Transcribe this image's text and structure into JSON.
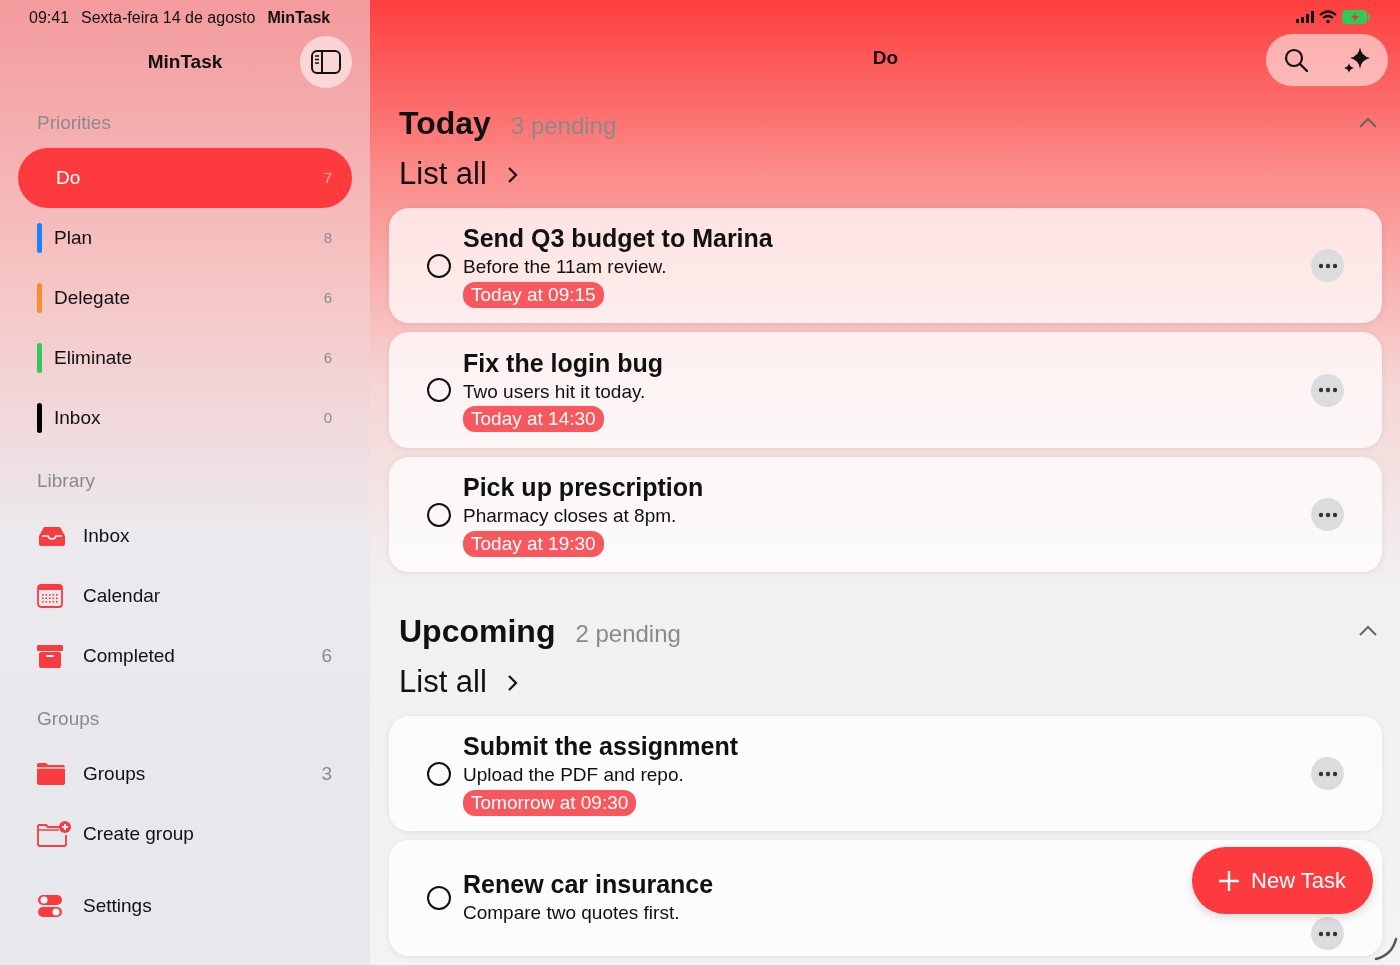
{
  "status_bar": {
    "time": "09:41",
    "date": "Sexta-feira 14 de agosto",
    "app": "MinTask"
  },
  "sidebar": {
    "title": "MinTask",
    "sections": [
      {
        "heading": "Priorities",
        "kind": "priority",
        "items": [
          {
            "label": "Do",
            "count": "7",
            "selected": true
          },
          {
            "label": "Plan",
            "count": "8",
            "selected": false,
            "color": "#1a82fb"
          },
          {
            "label": "Delegate",
            "count": "6",
            "selected": false,
            "color": "#fb8c2c"
          },
          {
            "label": "Eliminate",
            "count": "6",
            "selected": false,
            "color": "#34c759"
          },
          {
            "label": "Inbox",
            "count": "0",
            "selected": false,
            "color": "#000000"
          }
        ]
      },
      {
        "heading": "Library",
        "kind": "library",
        "items": [
          {
            "label": "Inbox",
            "selected": false
          },
          {
            "label": "Calendar",
            "selected": false
          },
          {
            "label": "Completed",
            "count": "6",
            "selected": false
          }
        ]
      },
      {
        "heading": "Groups",
        "kind": "groups",
        "items": [
          {
            "label": "Groups",
            "count": "3",
            "selected": false
          },
          {
            "label": "Create group",
            "selected": false
          }
        ]
      }
    ],
    "settings": "Settings"
  },
  "main": {
    "title": "Do",
    "sections": [
      {
        "title": "Today",
        "pending": "3 pending",
        "expanded": true,
        "link": "List all",
        "tasks": [
          {
            "title": "Send Q3 budget to Marina",
            "note": "Before the 11am review.",
            "due": "Today at 09:15",
            "checked": false
          },
          {
            "title": "Fix the login bug",
            "note": "Two users hit it today.",
            "due": "Today at 14:30",
            "checked": false
          },
          {
            "title": "Pick up prescription",
            "note": "Pharmacy closes at 8pm.",
            "due": "Today at 19:30",
            "checked": false
          }
        ]
      },
      {
        "title": "Upcoming",
        "pending": "2 pending",
        "expanded": true,
        "link": "List all",
        "tasks": [
          {
            "title": "Submit the assignment",
            "note": "Upload the PDF and repo.",
            "due": "Tomorrow at 09:30",
            "checked": false
          },
          {
            "title": "Renew car insurance",
            "note": "Compare two quotes first.",
            "checked": false
          }
        ]
      }
    ],
    "new_task": "New Task"
  }
}
